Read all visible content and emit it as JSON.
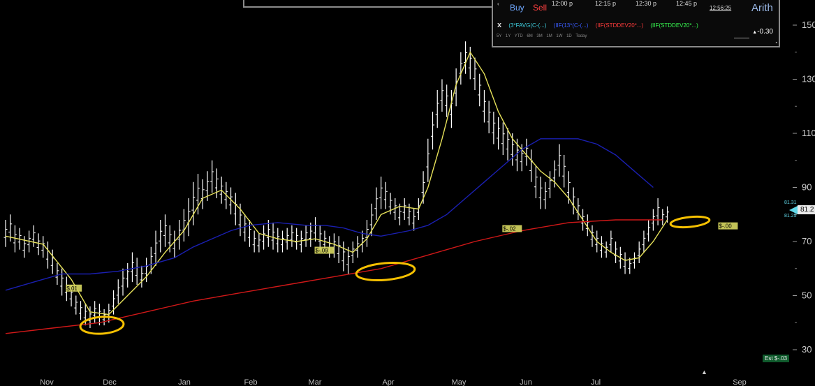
{
  "overlay": {
    "buy_label": "Buy",
    "sell_label": "Sell",
    "times": [
      "12:00 p",
      "12:15 p",
      "12:30 p",
      "12:45 p"
    ],
    "clock": "12:56:25",
    "scale_label": "Arith",
    "close_label": "x",
    "studies": [
      "(3*FAVG(C-(...)",
      "(IIF(13*(C-(...)",
      "(IIF(STDDEV20*...)",
      "(IIF(STDDEV20*...)"
    ],
    "ranges": [
      "5Y",
      "1Y",
      "YTD",
      "6M",
      "3M",
      "1M",
      "1W",
      "1D",
      "Today"
    ],
    "readout": "-0.30"
  },
  "price_marker": {
    "value": "81.2",
    "high": "81.31",
    "low": "81.25"
  },
  "estimate_badge": "Est $-.03",
  "colors": {
    "background": "#000000",
    "bars": "#ffffff",
    "sma_fast": "#e6e15a",
    "sma_mid": "#1a1fb0",
    "sma_slow": "#d01818",
    "markup": "#f5c000",
    "label_bg": "#d8d860"
  },
  "chart_data": {
    "type": "line",
    "x_tick_labels": [
      "Nov",
      "Dec",
      "Jan",
      "Feb",
      "Mar",
      "Apr",
      "May",
      "Jun",
      "Jul",
      "Sep"
    ],
    "y_tick_labels": [
      "150",
      "130",
      "110",
      "90",
      "70",
      "50",
      "30"
    ],
    "y_ticks": [
      150,
      130,
      110,
      90,
      70,
      50,
      30
    ],
    "ylim": [
      25,
      160
    ],
    "grid": false,
    "x_axis_position": "bottom",
    "y_axis_position": "right",
    "bars": [
      [
        0,
        78,
        68
      ],
      [
        1,
        80,
        70
      ],
      [
        2,
        76,
        66
      ],
      [
        3,
        75,
        67
      ],
      [
        4,
        72,
        64
      ],
      [
        5,
        74,
        66
      ],
      [
        6,
        76,
        68
      ],
      [
        7,
        73,
        65
      ],
      [
        8,
        72,
        64
      ],
      [
        9,
        70,
        60
      ],
      [
        10,
        67,
        58
      ],
      [
        11,
        62,
        54
      ],
      [
        12,
        60,
        50
      ],
      [
        13,
        57,
        48
      ],
      [
        14,
        54,
        46
      ],
      [
        15,
        50,
        43
      ],
      [
        16,
        48,
        41
      ],
      [
        17,
        47,
        39
      ],
      [
        18,
        46,
        38
      ],
      [
        19,
        48,
        40
      ],
      [
        20,
        47,
        39
      ],
      [
        21,
        45,
        39
      ],
      [
        22,
        47,
        40
      ],
      [
        23,
        52,
        43
      ],
      [
        24,
        56,
        47
      ],
      [
        25,
        60,
        50
      ],
      [
        26,
        62,
        53
      ],
      [
        27,
        66,
        55
      ],
      [
        28,
        64,
        54
      ],
      [
        29,
        61,
        53
      ],
      [
        30,
        64,
        55
      ],
      [
        31,
        68,
        58
      ],
      [
        32,
        74,
        61
      ],
      [
        33,
        78,
        66
      ],
      [
        34,
        80,
        68
      ],
      [
        35,
        76,
        66
      ],
      [
        36,
        74,
        64
      ],
      [
        37,
        78,
        67
      ],
      [
        38,
        82,
        70
      ],
      [
        39,
        86,
        72
      ],
      [
        40,
        92,
        76
      ],
      [
        41,
        95,
        80
      ],
      [
        42,
        93,
        82
      ],
      [
        43,
        96,
        85
      ],
      [
        44,
        100,
        88
      ],
      [
        45,
        97,
        86
      ],
      [
        46,
        94,
        84
      ],
      [
        47,
        92,
        82
      ],
      [
        48,
        90,
        80
      ],
      [
        49,
        88,
        76
      ],
      [
        50,
        84,
        72
      ],
      [
        51,
        80,
        70
      ],
      [
        52,
        78,
        68
      ],
      [
        53,
        74,
        66
      ],
      [
        54,
        73,
        66
      ],
      [
        55,
        76,
        67
      ],
      [
        56,
        78,
        68
      ],
      [
        57,
        77,
        67
      ],
      [
        58,
        75,
        66
      ],
      [
        59,
        74,
        66
      ],
      [
        60,
        75,
        67
      ],
      [
        61,
        76,
        68
      ],
      [
        62,
        75,
        67
      ],
      [
        63,
        74,
        66
      ],
      [
        64,
        76,
        68
      ],
      [
        65,
        77,
        68
      ],
      [
        66,
        79,
        70
      ],
      [
        67,
        76,
        67
      ],
      [
        68,
        74,
        66
      ],
      [
        69,
        72,
        64
      ],
      [
        70,
        73,
        64
      ],
      [
        71,
        72,
        62
      ],
      [
        72,
        70,
        59
      ],
      [
        73,
        68,
        58
      ],
      [
        74,
        70,
        62
      ],
      [
        75,
        72,
        64
      ],
      [
        76,
        74,
        66
      ],
      [
        77,
        78,
        68
      ],
      [
        78,
        84,
        72
      ],
      [
        79,
        90,
        78
      ],
      [
        80,
        94,
        82
      ],
      [
        81,
        92,
        82
      ],
      [
        82,
        88,
        80
      ],
      [
        83,
        86,
        78
      ],
      [
        84,
        84,
        76
      ],
      [
        85,
        86,
        78
      ],
      [
        86,
        84,
        76
      ],
      [
        87,
        82,
        74
      ],
      [
        88,
        86,
        78
      ],
      [
        89,
        96,
        84
      ],
      [
        90,
        108,
        92
      ],
      [
        91,
        118,
        104
      ],
      [
        92,
        126,
        112
      ],
      [
        93,
        130,
        118
      ],
      [
        94,
        128,
        116
      ],
      [
        95,
        126,
        112
      ],
      [
        96,
        134,
        120
      ],
      [
        97,
        140,
        128
      ],
      [
        98,
        144,
        132
      ],
      [
        99,
        142,
        130
      ],
      [
        100,
        138,
        126
      ],
      [
        101,
        132,
        120
      ],
      [
        102,
        126,
        114
      ],
      [
        103,
        122,
        110
      ],
      [
        104,
        118,
        106
      ],
      [
        105,
        116,
        104
      ],
      [
        106,
        114,
        102
      ],
      [
        107,
        112,
        100
      ],
      [
        108,
        110,
        98
      ],
      [
        109,
        108,
        96
      ],
      [
        110,
        106,
        96
      ],
      [
        111,
        108,
        98
      ],
      [
        112,
        104,
        92
      ],
      [
        113,
        98,
        86
      ],
      [
        114,
        94,
        82
      ],
      [
        115,
        92,
        82
      ],
      [
        116,
        96,
        86
      ],
      [
        117,
        100,
        90
      ],
      [
        118,
        106,
        94
      ],
      [
        119,
        102,
        90
      ],
      [
        120,
        96,
        84
      ],
      [
        121,
        90,
        80
      ],
      [
        122,
        86,
        78
      ],
      [
        123,
        82,
        74
      ],
      [
        124,
        80,
        72
      ],
      [
        125,
        76,
        68
      ],
      [
        126,
        74,
        66
      ],
      [
        127,
        72,
        64
      ],
      [
        128,
        70,
        64
      ],
      [
        129,
        74,
        66
      ],
      [
        130,
        70,
        62
      ],
      [
        131,
        68,
        60
      ],
      [
        132,
        66,
        58
      ],
      [
        133,
        64,
        58
      ],
      [
        134,
        66,
        60
      ],
      [
        135,
        70,
        62
      ],
      [
        136,
        74,
        66
      ],
      [
        137,
        78,
        70
      ],
      [
        138,
        82,
        74
      ],
      [
        139,
        86,
        76
      ],
      [
        140,
        82,
        76
      ],
      [
        141,
        83,
        77
      ]
    ],
    "series": [
      {
        "points": [
          [
            0,
            72
          ],
          [
            8,
            69
          ],
          [
            14,
            56
          ],
          [
            18,
            44
          ],
          [
            22,
            43
          ],
          [
            26,
            50
          ],
          [
            30,
            57
          ],
          [
            34,
            66
          ],
          [
            38,
            74
          ],
          [
            42,
            86
          ],
          [
            46,
            89
          ],
          [
            50,
            82
          ],
          [
            54,
            73
          ],
          [
            58,
            71
          ],
          [
            62,
            70
          ],
          [
            66,
            71
          ],
          [
            70,
            69
          ],
          [
            74,
            66
          ],
          [
            77,
            71
          ],
          [
            80,
            80
          ],
          [
            84,
            83
          ],
          [
            88,
            82
          ],
          [
            90,
            90
          ],
          [
            93,
            108
          ],
          [
            96,
            128
          ],
          [
            99,
            140
          ],
          [
            102,
            132
          ],
          [
            105,
            118
          ],
          [
            108,
            108
          ],
          [
            111,
            102
          ],
          [
            114,
            96
          ],
          [
            117,
            92
          ],
          [
            120,
            86
          ],
          [
            123,
            78
          ],
          [
            126,
            70
          ],
          [
            129,
            66
          ],
          [
            132,
            63
          ],
          [
            135,
            64
          ],
          [
            138,
            70
          ],
          [
            141,
            78
          ]
        ]
      },
      {
        "points": [
          [
            0,
            52
          ],
          [
            6,
            55
          ],
          [
            12,
            58
          ],
          [
            18,
            58
          ],
          [
            24,
            59
          ],
          [
            30,
            61
          ],
          [
            36,
            64
          ],
          [
            40,
            68
          ],
          [
            44,
            71
          ],
          [
            48,
            74
          ],
          [
            52,
            76
          ],
          [
            58,
            77
          ],
          [
            64,
            76
          ],
          [
            68,
            76
          ],
          [
            72,
            75
          ],
          [
            76,
            73
          ],
          [
            80,
            72
          ],
          [
            86,
            74
          ],
          [
            90,
            76
          ],
          [
            94,
            80
          ],
          [
            98,
            86
          ],
          [
            102,
            92
          ],
          [
            106,
            98
          ],
          [
            110,
            104
          ],
          [
            114,
            108
          ],
          [
            118,
            108
          ],
          [
            122,
            108
          ],
          [
            126,
            106
          ],
          [
            130,
            102
          ],
          [
            134,
            96
          ],
          [
            138,
            90
          ]
        ]
      },
      {
        "points": [
          [
            0,
            36
          ],
          [
            10,
            38
          ],
          [
            20,
            40
          ],
          [
            30,
            44
          ],
          [
            40,
            48
          ],
          [
            50,
            51
          ],
          [
            60,
            54
          ],
          [
            70,
            57
          ],
          [
            80,
            60
          ],
          [
            90,
            65
          ],
          [
            100,
            70
          ],
          [
            110,
            74
          ],
          [
            120,
            77
          ],
          [
            130,
            78
          ],
          [
            140,
            78
          ]
        ]
      }
    ],
    "labels": [
      {
        "text": "$.01",
        "x": 13,
        "y": 52
      },
      {
        "text": "$-.09",
        "x": 66,
        "y": 66
      },
      {
        "text": "$-.02",
        "x": 106,
        "y": 74
      },
      {
        "text": "$-.00",
        "x": 152,
        "y": 75
      }
    ]
  }
}
